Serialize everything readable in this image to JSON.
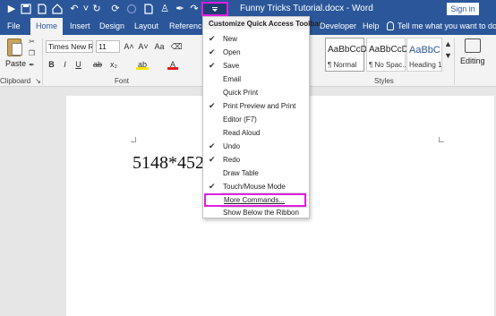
{
  "window": {
    "title": "Funny Tricks Tutorial.docx - Word",
    "signin_label": "Sign in"
  },
  "qat": {
    "icons": [
      "save-icon",
      "document-icon",
      "home-icon",
      "undo-icon",
      "redo-icon",
      "circle-icon",
      "document-icon",
      "person-icon",
      "redo-icon",
      "customize-dropdown-icon"
    ]
  },
  "tabs": [
    "File",
    "Home",
    "Insert",
    "Design",
    "Layout",
    "References",
    "Developer",
    "Help"
  ],
  "active_tab": "Home",
  "tell_me": "Tell me what you want to do",
  "ribbon": {
    "clipboard": {
      "paste_label": "Paste",
      "group_label": "Clipboard"
    },
    "font": {
      "font_name": "Times New Ro",
      "font_size": "11",
      "grow_label": "A˄",
      "shrink_label": "A˅",
      "case_label": "Aa",
      "bold_label": "B",
      "italic_label": "I",
      "underline_label": "U",
      "strike_label": "ab",
      "subscript_label": "x₂",
      "highlight_label": "ab",
      "color_label": "A",
      "group_label": "Font"
    },
    "styles": {
      "items": [
        {
          "sample": "AaBbCcD",
          "name": "¶ Normal"
        },
        {
          "sample": "AaBbCcD",
          "name": "¶ No Spac..."
        },
        {
          "sample": "AaBbC",
          "name": "Heading 1"
        }
      ],
      "group_label": "Styles"
    },
    "editing": {
      "label": "Editing"
    }
  },
  "document": {
    "text": "5148*452"
  },
  "menu": {
    "title": "Customize Quick Access Toolbar",
    "items": [
      {
        "label": "New",
        "checked": "✔"
      },
      {
        "label": "Open",
        "checked": "✔"
      },
      {
        "label": "Save",
        "checked": "✔"
      },
      {
        "label": "Email",
        "checked": ""
      },
      {
        "label": "Quick Print",
        "checked": ""
      },
      {
        "label": "Print Preview and Print",
        "checked": "✔"
      },
      {
        "label": "Editor (F7)",
        "checked": ""
      },
      {
        "label": "Read Aloud",
        "checked": ""
      },
      {
        "label": "Undo",
        "checked": "✔"
      },
      {
        "label": "Redo",
        "checked": "✔"
      },
      {
        "label": "Draw Table",
        "checked": ""
      },
      {
        "label": "Touch/Mouse Mode",
        "checked": "✔"
      },
      {
        "label": "More Commands...",
        "checked": ""
      },
      {
        "label": "Show Below the Ribbon",
        "checked": ""
      }
    ]
  },
  "colors": {
    "title_bar": "#2b579a",
    "highlight_outline": "#e11ee1",
    "font_color_red": "#e02020",
    "highlight_yellow": "#ffe600"
  }
}
